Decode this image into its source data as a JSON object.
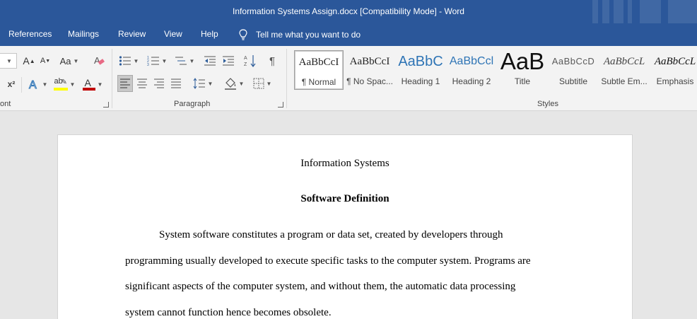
{
  "window": {
    "title": "Information Systems Assign.docx [Compatibility Mode]  -  Word"
  },
  "menu": {
    "tabs": [
      "References",
      "Mailings",
      "Review",
      "View",
      "Help"
    ],
    "tell_me": "Tell me what you want to do"
  },
  "ribbon": {
    "groups": {
      "font": "ont",
      "paragraph": "Paragraph",
      "styles": "Styles"
    },
    "font_buttons": {
      "grow": "A",
      "shrink": "A",
      "change_case": "Aa",
      "superscript": "x²",
      "highlight": "ab",
      "font_color": "A"
    },
    "font_color": "#c00000",
    "highlight_color": "#ffff00",
    "styles": [
      {
        "sample": "AaBbCcI",
        "name": "¶ Normal",
        "selected": true
      },
      {
        "sample": "AaBbCcI",
        "name": "¶ No Spac..."
      },
      {
        "sample": "AaBbC",
        "name": "Heading 1"
      },
      {
        "sample": "AaBbCcl",
        "name": "Heading 2"
      },
      {
        "sample": "AaB",
        "name": "Title"
      },
      {
        "sample": "AaBbCcD",
        "name": "Subtitle"
      },
      {
        "sample": "AaBbCcL",
        "name": "Subtle Em..."
      },
      {
        "sample": "AaBbCcL",
        "name": "Emphasis"
      }
    ]
  },
  "document": {
    "title": "Information Systems",
    "heading": "Software Definition",
    "paragraph_lines": [
      "System software constitutes a program or data set, created by developers through",
      "programming usually developed to execute specific tasks to the computer system. Programs are",
      "significant aspects of the computer system, and without them, the automatic data processing",
      "system cannot function hence becomes obsolete."
    ]
  },
  "colors": {
    "titlebar": "#2b579a",
    "ribbon": "#f3f3f3",
    "canvas": "#e6e6e6",
    "heading1": "#2e74b5"
  }
}
